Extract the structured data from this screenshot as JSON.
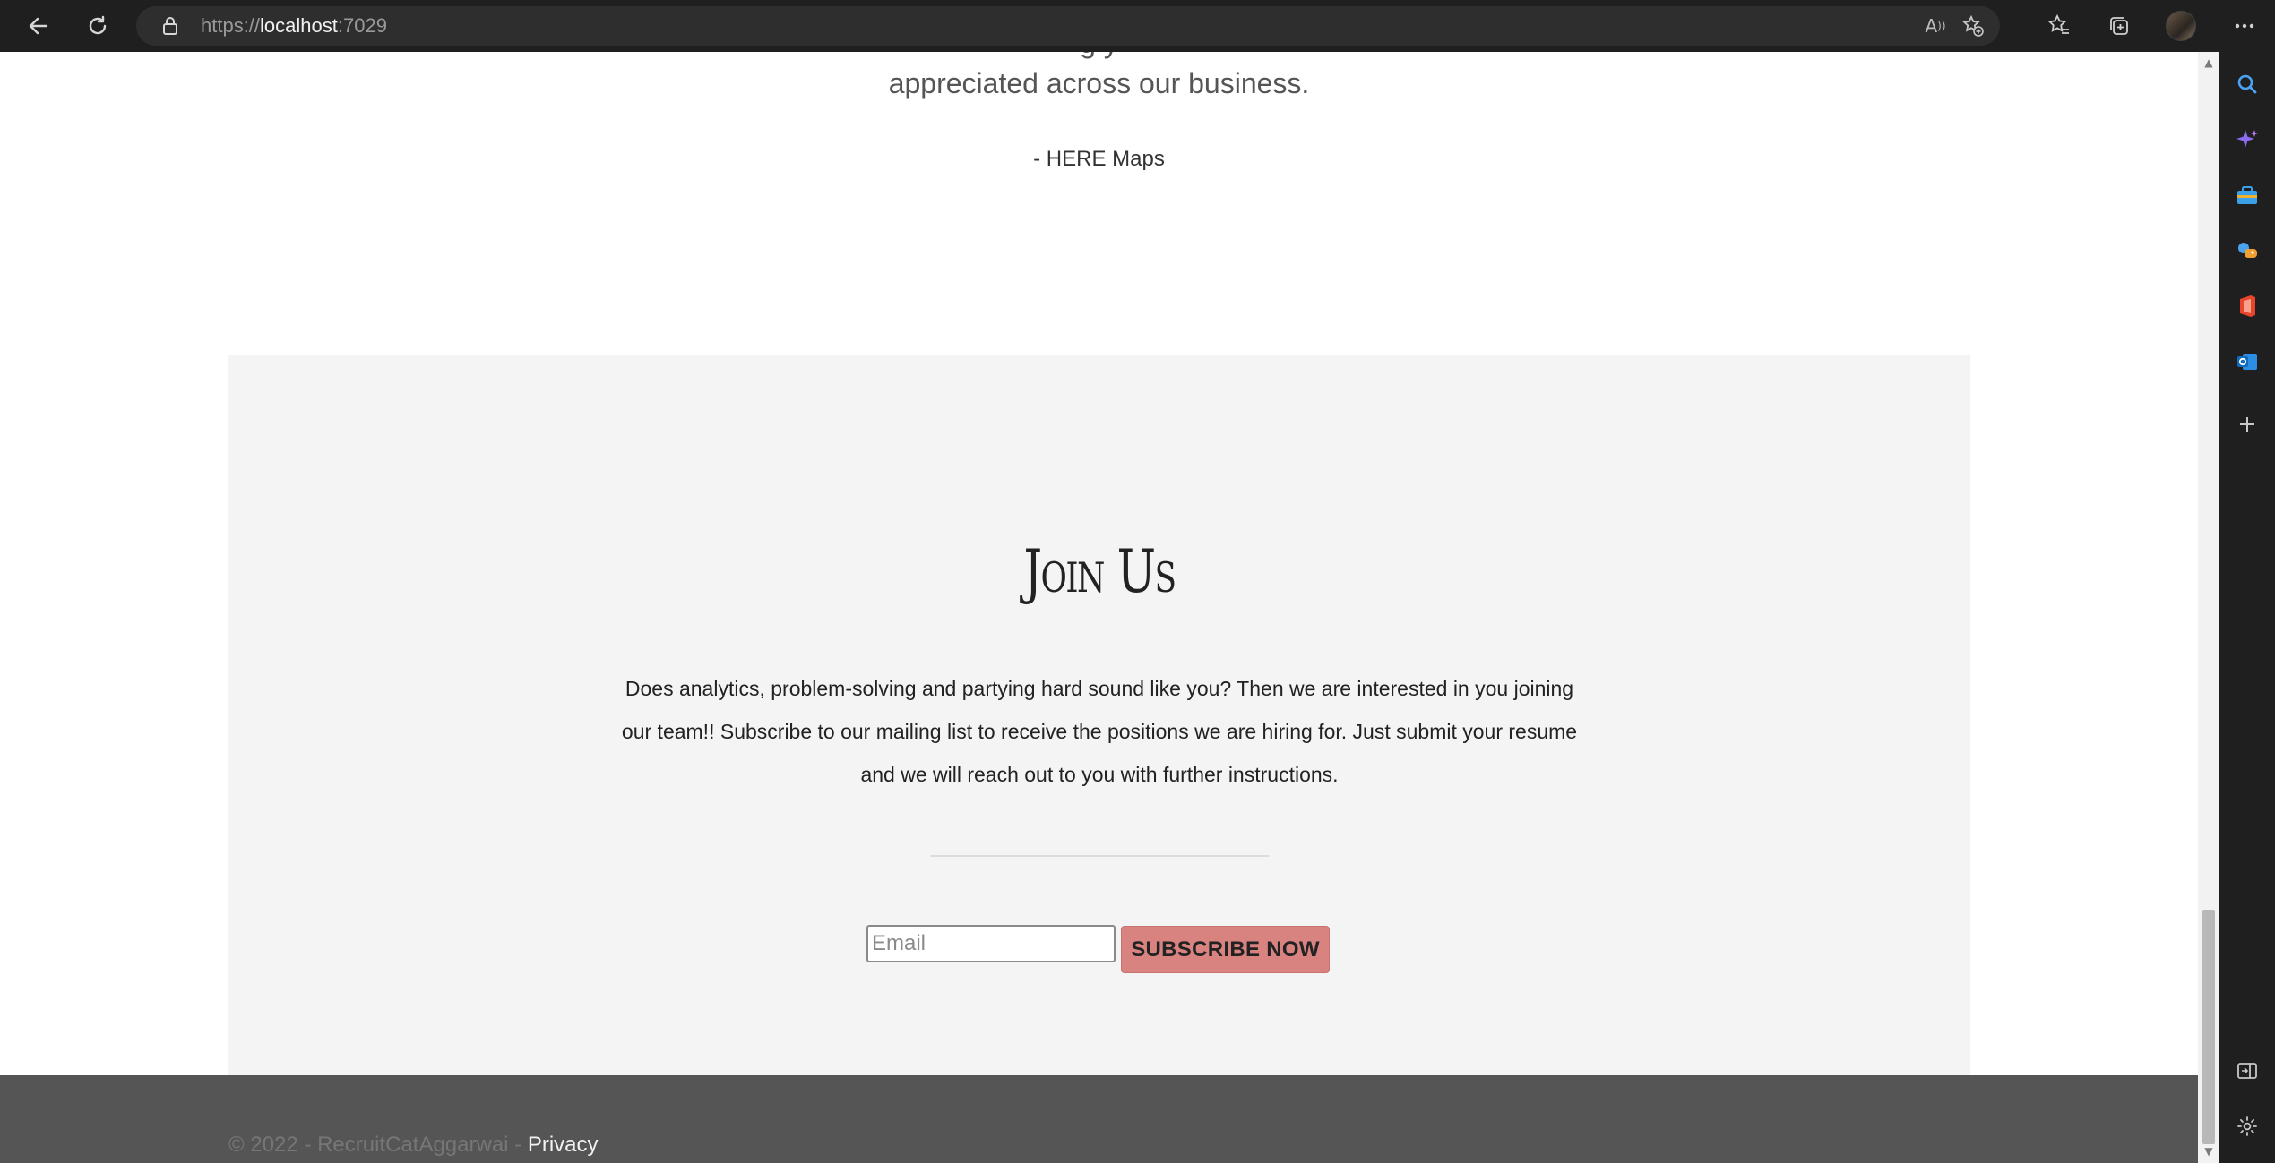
{
  "browser": {
    "url_scheme": "https://",
    "url_host": "localhost",
    "url_port": ":7029"
  },
  "page": {
    "quote_partial": "g                                                                  y",
    "quote_line": "appreciated across our business.",
    "quote_author": "- HERE Maps",
    "join": {
      "title": "Join Us",
      "text": "Does analytics, problem-solving and partying hard sound like you? Then we are interested in you joining our team!! Subscribe to our mailing list to receive the positions we are hiring for. Just submit your resume and we will reach out to you with further instructions.",
      "email_placeholder": "Email",
      "subscribe_label": "SUBSCRIBE NOW"
    },
    "footer": {
      "copyright": "© 2022 - RecruitCatAggarwai - ",
      "privacy_label": "Privacy"
    }
  },
  "icons": {
    "back": "back-arrow-icon",
    "refresh": "refresh-icon",
    "lock": "lock-icon",
    "read_aloud": "read-aloud-icon",
    "add_favorite": "add-favorite-icon",
    "favorites": "favorites-icon",
    "collections": "collections-icon",
    "profile": "profile-avatar",
    "more": "more-icon"
  },
  "colors": {
    "subscribe_button": "#d98380",
    "section_bg": "#f4f4f4",
    "footer_bg": "#555555"
  }
}
